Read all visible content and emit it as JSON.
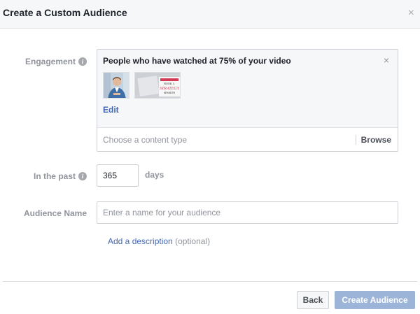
{
  "dialog": {
    "title": "Create a Custom Audience",
    "close_glyph": "×"
  },
  "engagement": {
    "label": "Engagement",
    "info_glyph": "i",
    "selected_title": "People who have watched at 75% of your video",
    "remove_glyph": "×",
    "edit_label": "Edit",
    "thumb_book_line1": "BOOK 1:",
    "thumb_book_line2": "STRATEGY",
    "thumb_book_line3": "SESSION",
    "content_type_placeholder": "Choose a content type",
    "browse_label": "Browse"
  },
  "in_the_past": {
    "label": "In the past",
    "info_glyph": "i",
    "value": "365",
    "unit": "days"
  },
  "audience_name": {
    "label": "Audience Name",
    "placeholder": "Enter a name for your audience",
    "add_description": "Add a description",
    "optional": "(optional)"
  },
  "footer": {
    "back_label": "Back",
    "create_label": "Create Audience"
  },
  "colors": {
    "link": "#4267b2",
    "primary_disabled": "#9cb4d8",
    "label_gray": "#90949c"
  }
}
